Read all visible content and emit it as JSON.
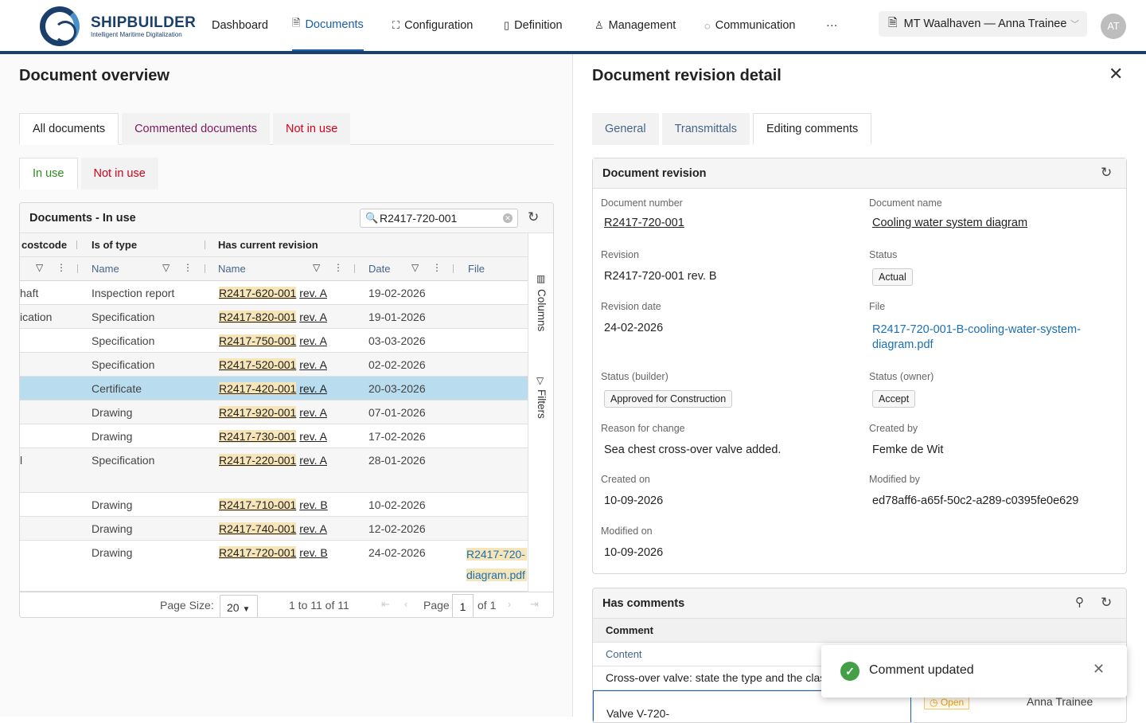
{
  "header": {
    "logo": {
      "name": "SHIPBUILDER",
      "tagline": "Intelligent Maritime Digitalization"
    },
    "nav": [
      {
        "label": "Dashboard",
        "icon": ""
      },
      {
        "label": "Documents",
        "icon": "document-icon"
      },
      {
        "label": "Configuration",
        "icon": "hierarchy-icon"
      },
      {
        "label": "Definition",
        "icon": "book-icon"
      },
      {
        "label": "Management",
        "icon": "user-icon"
      },
      {
        "label": "Communication",
        "icon": "chat-icon"
      }
    ],
    "more": "···",
    "ship_selector": "MT Waalhaven — Anna Trainee",
    "avatar": "AT"
  },
  "left": {
    "title": "Document overview",
    "tabs": [
      "All documents",
      "Commented documents",
      "Not in use"
    ],
    "subtabs": [
      "In use",
      "Not in use"
    ],
    "grid": {
      "title": "Documents - In use",
      "search_value": "R2417-720-001",
      "group_headers": [
        "costcode",
        "Is of type",
        "Has current revision"
      ],
      "columns": [
        "Name",
        "Name",
        "Date",
        "File"
      ],
      "side_panels": [
        "Columns",
        "Filters"
      ],
      "rows": [
        {
          "c1": "haft",
          "type": "Inspection report",
          "doc": "R2417-620-001",
          "rev": "rev. A",
          "date": "19-02-2026"
        },
        {
          "c1": "ication",
          "type": "Specification",
          "doc": "R2417-820-001",
          "rev": "rev. A",
          "date": "19-01-2026"
        },
        {
          "c1": "",
          "type": "Specification",
          "doc": "R2417-750-001",
          "rev": "rev. A",
          "date": "03-03-2026"
        },
        {
          "c1": "",
          "type": "Specification",
          "doc": "R2417-520-001",
          "rev": "rev. A",
          "date": "02-02-2026"
        },
        {
          "c1": "",
          "type": "Certificate",
          "doc": "R2417-420-001",
          "rev": "rev. A",
          "date": "20-03-2026"
        },
        {
          "c1": "",
          "type": "Drawing",
          "doc": "R2417-920-001",
          "rev": "rev. A",
          "date": "07-01-2026"
        },
        {
          "c1": "",
          "type": "Drawing",
          "doc": "R2417-730-001",
          "rev": "rev. A",
          "date": "17-02-2026"
        },
        {
          "c1": "l",
          "type": "Specification",
          "doc": "R2417-220-001",
          "rev": "rev. A",
          "date": "28-01-2026"
        },
        {
          "c1": "",
          "type": "Drawing",
          "doc": "R2417-710-001",
          "rev": "rev. B",
          "date": "10-02-2026"
        },
        {
          "c1": "",
          "type": "Drawing",
          "doc": "R2417-740-001",
          "rev": "rev. A",
          "date": "12-02-2026"
        },
        {
          "c1": "",
          "type": "Drawing",
          "doc": "R2417-720-001",
          "rev": "rev. B",
          "date": "24-02-2026",
          "file": "R2417-720-",
          "file2": "diagram.pdf"
        }
      ],
      "pager": {
        "page_size_label": "Page Size:",
        "page_size": "20",
        "range": "1 to 11 of 11",
        "page_label": "Page",
        "page": "1",
        "of": "of 1"
      }
    }
  },
  "right": {
    "title": "Document revision detail",
    "tabs": [
      "General",
      "Transmittals",
      "Editing comments"
    ],
    "revision": {
      "title": "Document revision",
      "fields": {
        "doc_number_label": "Document number",
        "doc_number": "R2417-720-001",
        "doc_name_label": "Document name",
        "doc_name": "Cooling water system diagram",
        "revision_label": "Revision",
        "revision": "R2417-720-001 rev. B",
        "status_label": "Status",
        "status": "Actual",
        "rev_date_label": "Revision date",
        "rev_date": "24-02-2026",
        "file_label": "File",
        "file_line1": "R2417-720-001-B-cooling-water-system-",
        "file_line2": "diagram.pdf",
        "status_builder_label": "Status (builder)",
        "status_builder": "Approved for Construction",
        "status_owner_label": "Status (owner)",
        "status_owner": "Accept",
        "reason_label": "Reason for change",
        "reason": "Sea chest cross-over valve added.",
        "created_by_label": "Created by",
        "created_by": "Femke de Wit",
        "created_on_label": "Created on",
        "created_on": "10-09-2026",
        "modified_by_label": "Modified by",
        "modified_by": "ed78aff6-a65f-50c2-a289-c0395fe0e629",
        "modified_on_label": "Modified on",
        "modified_on": "10-09-2026"
      }
    },
    "comments": {
      "title": "Has comments",
      "group_header": "Comment",
      "column": "Content",
      "row1": "Cross-over valve: state the type and the clas",
      "row2": "Valve V-720-",
      "status": "Open",
      "user": "Anna Trainee"
    }
  },
  "toast": {
    "message": "Comment updated"
  }
}
